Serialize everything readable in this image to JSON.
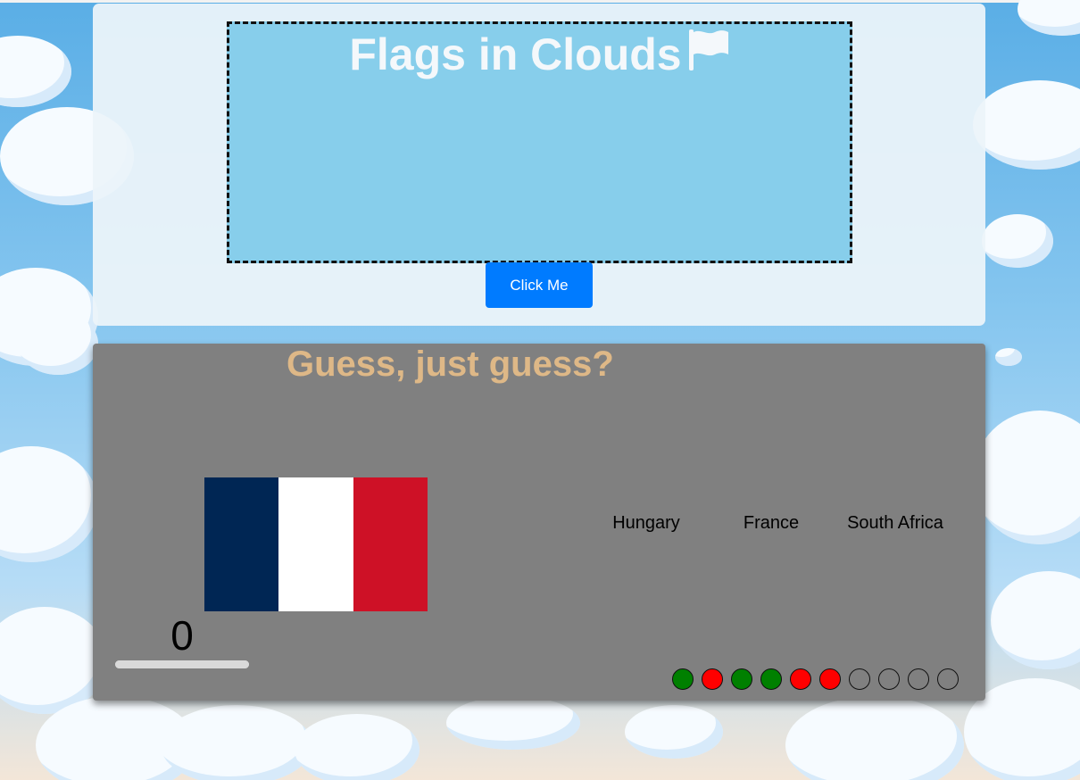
{
  "header": {
    "title": "Flags in Clouds",
    "title_icon": "white-flag-icon",
    "button_label": "Click Me",
    "button_color": "#007bff",
    "sky_color": "#87ceeb"
  },
  "game": {
    "heading": "Guess, just guess?",
    "heading_color": "#deb887",
    "panel_color": "#808080",
    "current_flag": {
      "stripes": [
        "#002654",
        "#ffffff",
        "#ce1126"
      ]
    },
    "score": "0",
    "timer_fraction": 1.0,
    "options": [
      "Hungary",
      "France",
      "South Africa"
    ],
    "results": [
      "correct",
      "wrong",
      "correct",
      "correct",
      "wrong",
      "wrong",
      "empty",
      "empty",
      "empty",
      "empty"
    ],
    "result_colors": {
      "correct": "#008000",
      "wrong": "#ff0000",
      "empty": "transparent"
    }
  }
}
